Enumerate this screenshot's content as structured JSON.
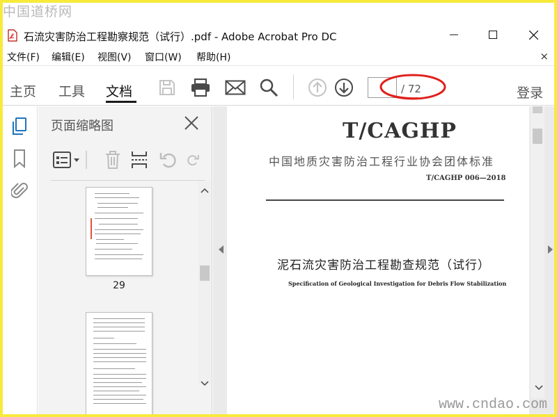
{
  "watermarks": {
    "top": "中国道桥网",
    "bottom": "www.cndao.com"
  },
  "window": {
    "title": "石流灾害防治工程勘察规范（试行）.pdf - Adobe Acrobat Pro DC",
    "icons": [
      "pdf-file-icon",
      "minimize-icon",
      "maximize-icon",
      "close-icon"
    ]
  },
  "menu": {
    "items": [
      "文件(F)",
      "编辑(E)",
      "视图(V)",
      "窗口(W)",
      "帮助(H)"
    ],
    "close": "×"
  },
  "toolbar": {
    "tabs": [
      "主页",
      "工具",
      "文档"
    ],
    "active_tab": "文档",
    "icons": [
      "save-icon",
      "print-icon",
      "email-icon",
      "search-icon",
      "page-up-icon",
      "page-down-icon"
    ],
    "page_current": "",
    "page_total": "/ 72",
    "login": "登录",
    "annotation_color": "#e0201c"
  },
  "rail": {
    "icons": [
      "page-thumbnails-icon",
      "bookmark-icon",
      "attachment-icon"
    ]
  },
  "thumbnail_panel": {
    "title": "页面缩略图",
    "tools": [
      "page-options-icon",
      "delete-icon",
      "insert-icon",
      "rotate-left-icon",
      "rotate-right-icon"
    ],
    "pages": [
      {
        "label": "29"
      },
      {
        "label": ""
      }
    ]
  },
  "document": {
    "code": "T/CAGHP",
    "association": "中国地质灾害防治工程行业协会团体标准",
    "standard_no": "T/CAGHP 006—2018",
    "title_cn": "泥石流灾害防治工程勘查规范（试行）",
    "title_en": "Specification of Geological Investigation for Debris Flow Stabilization"
  }
}
